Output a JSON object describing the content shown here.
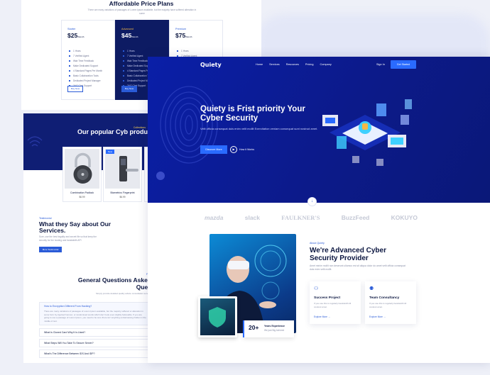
{
  "pricing": {
    "title": "Affordable Price Plans",
    "subtitle": "There are many variations of passages of Lorem Ipsum available, but the majority have suffered alteration in some",
    "plans": [
      {
        "name": "Starter",
        "price": "$25",
        "per": "/Month",
        "button": "Buy Now",
        "features": [
          "1 Years",
          "7 Verified Agent",
          "Wab Time Feedback",
          "Make Dedicated Support",
          "4 Standard Pages Per Month",
          "Basic Collaboration Tools",
          "Dedicated Project Manager",
          "24*7 Chat Support"
        ]
      },
      {
        "name": "Advanced",
        "price": "$45",
        "per": "/Month",
        "button": "Buy Now",
        "features": [
          "1 Years",
          "7 Verified Agent",
          "Wab Time Feedback",
          "Make Dedicated Support",
          "4 Standard Pages Per Month",
          "Basic Collaboration Tools",
          "Dedicated Project Manager",
          "24*7 Chat Support"
        ]
      },
      {
        "name": "Premium",
        "price": "$75",
        "per": "/Month",
        "button": "",
        "features": [
          "1 Years",
          "7 Verified Agent"
        ]
      }
    ]
  },
  "products": {
    "eyebrow": "Collections",
    "title": "Our popular Cyb produc",
    "items": [
      {
        "name": "Combination Padlock",
        "price": "$6.99",
        "badge": ""
      },
      {
        "name": "Biometrics Fingerprint",
        "price": "$6.99",
        "badge": "New"
      }
    ]
  },
  "testimonial": {
    "eyebrow": "Testimonial",
    "title": "What they Say about Our Services.",
    "desc": "Sure, use the best legality and secret file so that keep the security for the hosting and bandwidth API",
    "button": "More Testimonial"
  },
  "faq": {
    "eyebrow": "FAQ",
    "title": "General Questions Asked Ques",
    "desc": "Simply provide detailed quality advice consultation service.",
    "items": [
      {
        "q": "How to Encryption Different From Hacking?",
        "a": "There are many variations of passages of Lorem Ipsum available, but the majority suffered or alteration in some form by injected humour, or randomised words which don't look even slightly believable. If you are going to use a passage of Lorem Ipsum, you need to be sure there isn't anything embarrassing hidden in the middle of text."
      },
      {
        "q": "What Is Cloned Card Why It Is Used?",
        "a": ""
      },
      {
        "q": "What Steps Will You Take To Secure Server?",
        "a": ""
      },
      {
        "q": "What's The Difference Between IDS And IDP?",
        "a": ""
      }
    ]
  },
  "header": {
    "logo": "Quiety",
    "nav": [
      "Home",
      "Services",
      "Resources",
      "Pricing",
      "Company"
    ],
    "signin": "Sign In",
    "cta": "Get Started"
  },
  "hero": {
    "title": "Quiety is Frist priority Your Cyber Security",
    "desc": "Velit officia consequat duis enim velit mollit Exercitation veniam consequat sunt nostrud amet.",
    "primary": "Discover More",
    "secondary": "How it Works"
  },
  "brands": [
    "mazda",
    "slack",
    "FAULKNER'S",
    "BuzzFeed",
    "KOKUYO"
  ],
  "about": {
    "eyebrow": "About Quiety",
    "title": "We're Advanced Cyber Security Provider",
    "desc": "Amet minim mollit non deserunt ullamco est sit aliqua dolor do amet velit officia consequat duis enim velit mollit.",
    "experience_num": "20+",
    "experience_label": "Years Experience",
    "experience_sub": "We just Big Achived",
    "services": [
      {
        "title": "Success Project",
        "desc": "If you use this is regularly bandwidth till cookout amet.",
        "more": "Explore More"
      },
      {
        "title": "Team Consultancy",
        "desc": "If you use this is regularly bandwidth till cookout amet.",
        "more": "Explore More"
      }
    ]
  },
  "colors": {
    "primary": "#2a6bff",
    "navy": "#0c1a8a",
    "accent": "#f5b945"
  }
}
